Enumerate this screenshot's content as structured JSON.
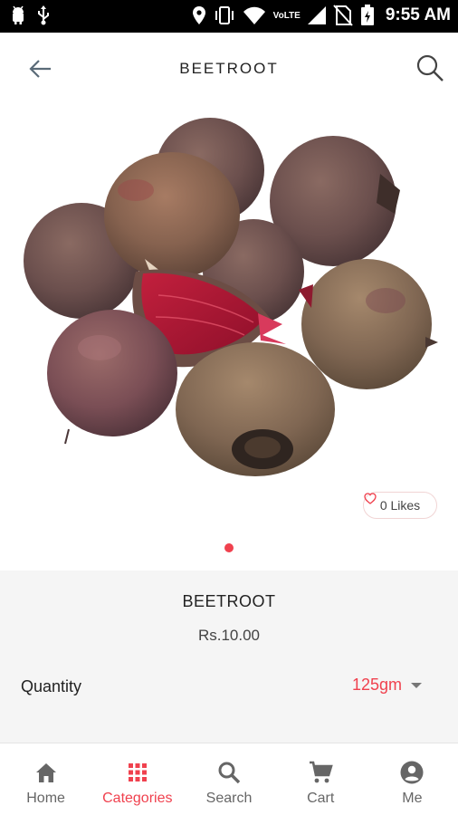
{
  "status_bar": {
    "time": "9:55 AM",
    "network_label": "VoLTE"
  },
  "app_bar": {
    "title": "BEETROOT",
    "back_icon": "arrow-left-icon",
    "search_icon": "search-icon"
  },
  "product": {
    "image_alt": "Beetroot",
    "likes_label": "0 Likes",
    "name": "BEETROOT",
    "price": "Rs.10.00",
    "quantity_label": "Quantity",
    "quantity_value": "125gm"
  },
  "pager": {
    "active_index": 0,
    "count": 1
  },
  "bottom_nav": {
    "items": [
      {
        "label": "Home",
        "icon": "home-icon"
      },
      {
        "label": "Categories",
        "icon": "grid-icon"
      },
      {
        "label": "Search",
        "icon": "search-icon"
      },
      {
        "label": "Cart",
        "icon": "cart-icon"
      },
      {
        "label": "Me",
        "icon": "account-icon"
      }
    ],
    "active": "Categories"
  },
  "colors": {
    "accent": "#f0414e",
    "inactive": "#666666",
    "details_bg": "#f5f5f5"
  }
}
